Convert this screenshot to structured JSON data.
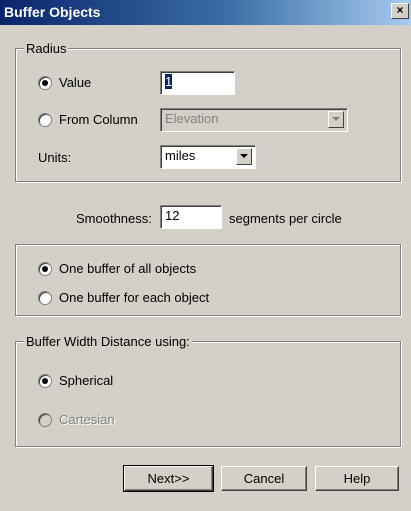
{
  "window": {
    "title": "Buffer Objects",
    "close_glyph": "×"
  },
  "radius": {
    "legend": "Radius",
    "value_option": "Value",
    "value_input": "1",
    "from_column_option": "From Column",
    "column_select": "Elevation",
    "units_label": "Units:",
    "units_select": "miles",
    "selected": "value"
  },
  "smoothness": {
    "label": "Smoothness:",
    "value": "12",
    "suffix": "segments per circle"
  },
  "buffer_mode": {
    "option_all": "One buffer of all objects",
    "option_each": "One buffer for each object",
    "selected": "all"
  },
  "distance": {
    "legend": "Buffer Width Distance using:",
    "option_spherical": "Spherical",
    "option_cartesian": "Cartesian",
    "selected": "spherical"
  },
  "buttons": {
    "next": "Next>>",
    "cancel": "Cancel",
    "help": "Help"
  }
}
